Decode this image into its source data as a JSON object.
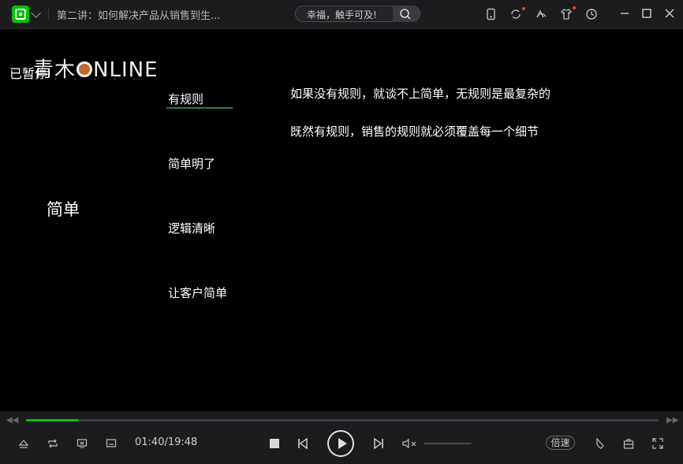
{
  "window": {
    "title": "第二讲：如何解决产品从销售到生...",
    "search_value": "幸福，触手可及!",
    "colors": {
      "accent": "#00c203",
      "titlebar_bg": "#1b1c1e",
      "video_bg": "#000000",
      "underline": "#2a7c4c"
    },
    "toolbar_icons": [
      "phone-icon",
      "refresh-icon",
      "cloud-icon",
      "shirt-icon",
      "history-icon"
    ],
    "window_icons": [
      "minimize-icon",
      "maximize-icon",
      "close-icon"
    ]
  },
  "video": {
    "status": "已暂停",
    "brand": {
      "name_prefix": "青木",
      "name_suffix": "NLINE"
    },
    "side_label": "简单",
    "menu": [
      {
        "label": "有规则",
        "active": true
      },
      {
        "label": "简单明了",
        "active": false
      },
      {
        "label": "逻辑清晰",
        "active": false
      },
      {
        "label": "让客户简单",
        "active": false
      }
    ],
    "content_lines": [
      "如果没有规则，就谈不上简单，无规则是最复杂的",
      "既然有规则，销售的规则就必须覆盖每一个细节"
    ]
  },
  "controls": {
    "time": "01:40/19:48",
    "progress": 0.084,
    "volume": 0.0,
    "speed_label": "倍速",
    "left_icons": [
      "eject-icon",
      "loop-icon",
      "screen-cast-icon",
      "subtitle-icon"
    ],
    "center_icons": [
      "stop-icon",
      "prev-icon",
      "play-icon",
      "next-icon",
      "volume-muted-icon"
    ],
    "right_icons": [
      "clip-icon",
      "toolbox-icon",
      "fullscreen-icon"
    ]
  }
}
